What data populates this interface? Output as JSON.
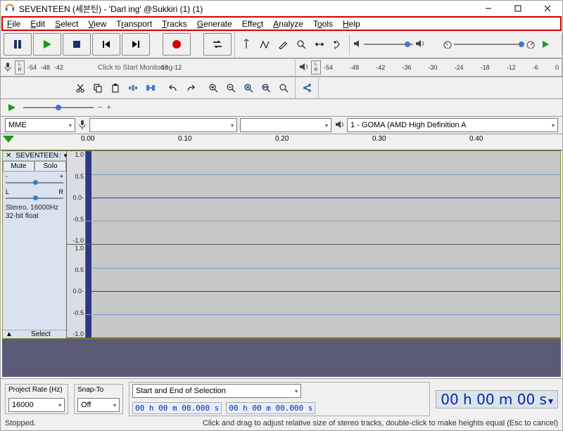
{
  "title": "SEVENTEEN (세븐틴) - 'Darl ing' @Sukkiri (1) (1)",
  "menu": [
    "File",
    "Edit",
    "Select",
    "View",
    "Transport",
    "Tracks",
    "Generate",
    "Effect",
    "Analyze",
    "Tools",
    "Help"
  ],
  "rec_meter": {
    "ticks": [
      "-54",
      "-48",
      "-42",
      "",
      "-18",
      "-12"
    ],
    "msg": "Click to Start Monitoring"
  },
  "play_meter": {
    "ticks": [
      "-54",
      "-48",
      "-42",
      "-36",
      "-30",
      "-24",
      "-18",
      "-12",
      "-6",
      "0"
    ]
  },
  "host_combo": "MME",
  "rec_device": "",
  "rec_channels": "",
  "play_device": "1 - GOMA (AMD High Definition A",
  "timeline_labels": [
    "0.00",
    "0.10",
    "0.20",
    "0.30",
    "0.40"
  ],
  "track_name": "SEVENTEEN",
  "mute": "Mute",
  "solo": "Solo",
  "pan_L": "L",
  "pan_R": "R",
  "gain_minus": "-",
  "gain_plus": "+",
  "track_info1": "Stereo, 16000Hz",
  "track_info2": "32-bit float",
  "select_label": "Select",
  "vscale": [
    "1.0",
    "0.5",
    "0.0-",
    "-0.5",
    "-1.0"
  ],
  "footer": {
    "project_rate_lbl": "Project Rate (Hz)",
    "project_rate_val": "16000",
    "snap_lbl": "Snap-To",
    "snap_val": "Off",
    "sel_lbl": "Start and End of Selection",
    "t1": "00 h 00 m 00.000 s",
    "t2": "00 h 00 m 00.000 s",
    "big_time": "00 h 00 m 00 s"
  },
  "status": {
    "left": "Stopped.",
    "right": "Click and drag to adjust relative size of stereo tracks, double-click to make heights equal (Esc to cancel)"
  }
}
